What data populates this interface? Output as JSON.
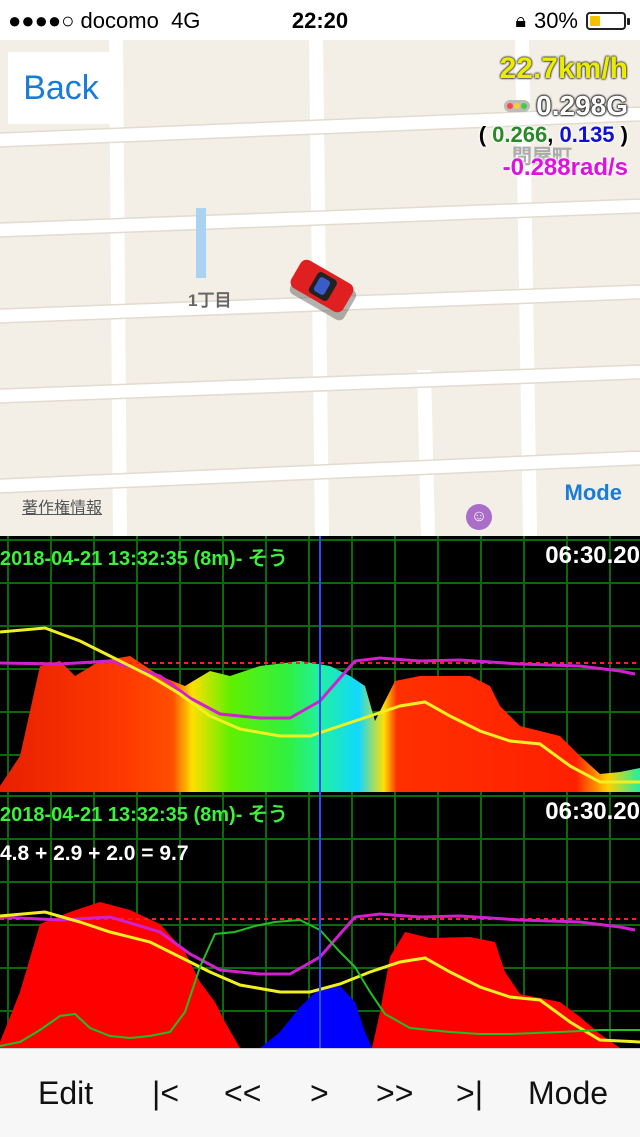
{
  "status_bar": {
    "carrier": "●●●●○ docomo",
    "network": "4G",
    "time": "22:20",
    "battery": "30%",
    "battery_level": 0.3,
    "lock_icon": "rotation-lock-icon"
  },
  "map": {
    "back_label": "Back",
    "mode_label": "Mode",
    "copyright": "著作権情報",
    "area_label": "1丁目",
    "ward_label": "問屋町",
    "speed": "22.7km/h",
    "g_total": "0.298G",
    "g_open": "(",
    "g_x": "0.266",
    "g_comma": ",",
    "g_y": "0.135",
    "g_close": ")",
    "rad": "-0.288rad/s",
    "colors": {
      "g_x": "#2a8a2a",
      "g_y": "#1010d0",
      "rad": "#e010e0",
      "speed": "#ecec00"
    }
  },
  "graph1": {
    "title": "2018-04-21 13:32:35 (8m)- そう",
    "time": "06:30.20"
  },
  "graph2": {
    "title": "2018-04-21 13:32:35 (8m)- そう",
    "time": "06:30.20",
    "sum": "4.8 + 2.9 + 2.0 = 9.7"
  },
  "toolbar": {
    "edit": "Edit",
    "first": "|<",
    "rewind": "<<",
    "play": ">",
    "forward": ">>",
    "last": ">|",
    "mode": "Mode"
  }
}
